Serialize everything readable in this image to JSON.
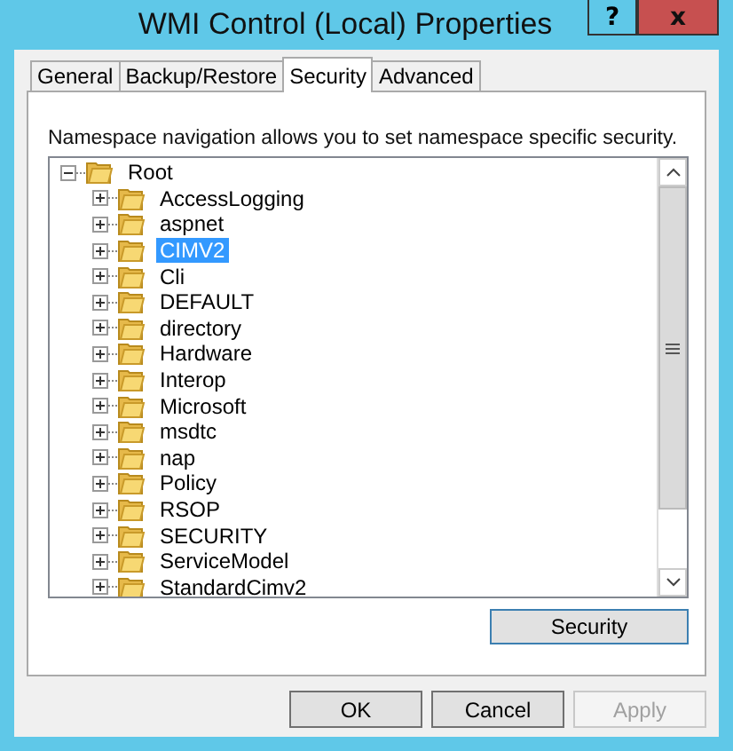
{
  "window": {
    "title": "WMI Control (Local) Properties",
    "buttons": [
      {
        "label": "?",
        "kind": "help"
      },
      {
        "label": "x",
        "kind": "close"
      }
    ]
  },
  "tabs": [
    {
      "label": "General",
      "selected": false
    },
    {
      "label": "Backup/Restore",
      "selected": false
    },
    {
      "label": "Security",
      "selected": true
    },
    {
      "label": "Advanced",
      "selected": false
    }
  ],
  "description": "Namespace navigation allows you to set namespace specific security.",
  "tree": [
    {
      "label": "Root",
      "expanded": true,
      "selected": false,
      "children": [
        {
          "label": "AccessLogging",
          "expanded": false,
          "selected": false
        },
        {
          "label": "aspnet",
          "expanded": false,
          "selected": false
        },
        {
          "label": "CIMV2",
          "expanded": false,
          "selected": true
        },
        {
          "label": "Cli",
          "expanded": false,
          "selected": false
        },
        {
          "label": "DEFAULT",
          "expanded": false,
          "selected": false
        },
        {
          "label": "directory",
          "expanded": false,
          "selected": false
        },
        {
          "label": "Hardware",
          "expanded": false,
          "selected": false
        },
        {
          "label": "Interop",
          "expanded": false,
          "selected": false
        },
        {
          "label": "Microsoft",
          "expanded": false,
          "selected": false
        },
        {
          "label": "msdtc",
          "expanded": false,
          "selected": false
        },
        {
          "label": "nap",
          "expanded": false,
          "selected": false
        },
        {
          "label": "Policy",
          "expanded": false,
          "selected": false
        },
        {
          "label": "RSOP",
          "expanded": false,
          "selected": false
        },
        {
          "label": "SECURITY",
          "expanded": false,
          "selected": false
        },
        {
          "label": "ServiceModel",
          "expanded": false,
          "selected": false
        },
        {
          "label": "StandardCimv2",
          "expanded": false,
          "selected": false
        }
      ]
    }
  ],
  "security_button": "Security",
  "buttons": [
    {
      "label": "OK",
      "disabled": false
    },
    {
      "label": "Cancel",
      "disabled": false
    },
    {
      "label": "Apply",
      "disabled": true
    }
  ]
}
